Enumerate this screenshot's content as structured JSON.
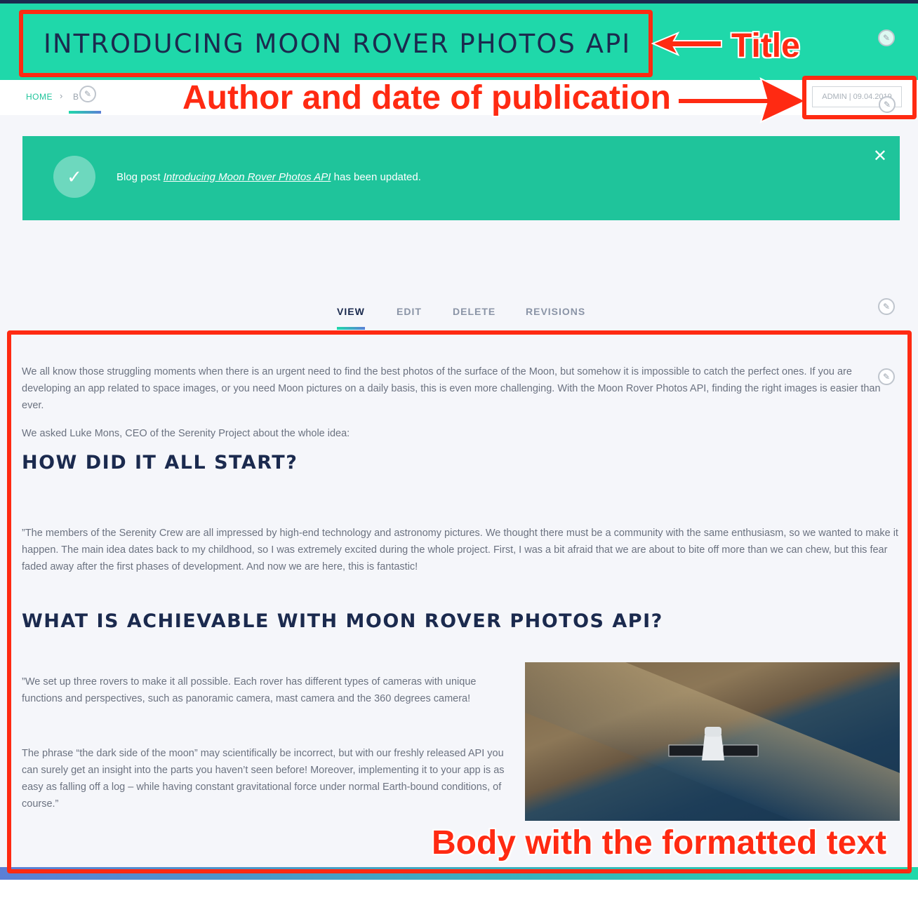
{
  "header": {
    "title": "INTRODUCING MOON ROVER PHOTOS API"
  },
  "breadcrumb": {
    "home": "HOME",
    "separator": "›",
    "current": "B"
  },
  "meta": {
    "author_date": "ADMIN | 09.04.2019"
  },
  "notice": {
    "prefix": "Blog post ",
    "link_text": "Introducing Moon Rover Photos API",
    "suffix": " has been updated.",
    "close": "✕",
    "check": "✓"
  },
  "tabs": [
    {
      "label": "VIEW",
      "active": true
    },
    {
      "label": "EDIT",
      "active": false
    },
    {
      "label": "DELETE",
      "active": false
    },
    {
      "label": "REVISIONS",
      "active": false
    }
  ],
  "article": {
    "p1": "We all know those struggling moments when there is an urgent need to find the best photos of  the surface of the Moon, but somehow it is impossible to catch the perfect ones. If you are developing an app related to space images, or you need Moon pictures on a daily basis, this is even more challenging. With the Moon Rover Photos API, finding the right images is easier than ever.",
    "p2": "We asked Luke Mons, CEO of the Serenity Project about the whole idea:",
    "h1": "HOW DID IT ALL START?",
    "p3": "”The members of the Serenity Crew are all impressed by high-end technology and astronomy pictures. We thought there must be a community with the same enthusiasm, so we wanted to make it happen. The main idea dates back to my childhood, so I was extremely excited during the whole project. First, I was a bit afraid that we are about to bite off more than we can chew, but this fear faded away after the first phases of development. And now we are here, this is fantastic!",
    "h2": "WHAT IS ACHIEVABLE WITH MOON ROVER PHOTOS API?",
    "p4": "”We set up three rovers to make it all possible. Each rover has different types of cameras with unique functions and perspectives, such as panoramic camera, mast camera and the 360 degrees camera!",
    "p5": "The phrase “the dark side of the moon” may scientifically be incorrect, but with our freshly released API you can surely get an insight into the parts you haven’t seen before! Moreover, implementing it to your app is as easy as falling off a log – while having constant gravitational force under normal Earth-bound conditions, of course.”"
  },
  "annotations": {
    "title": "Title",
    "author": "Author and date of publication",
    "body": "Body with the formatted text",
    "color": "#ff2a12"
  },
  "icons": {
    "edit": "pencil-icon"
  }
}
